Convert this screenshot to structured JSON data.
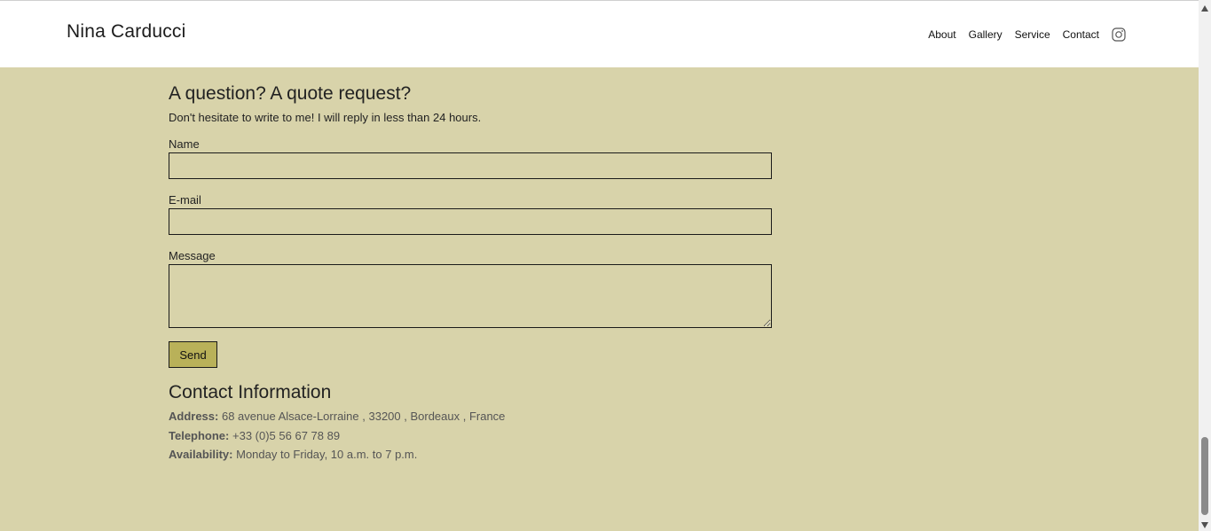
{
  "header": {
    "brand": "Nina Carducci",
    "nav": [
      "About",
      "Gallery",
      "Service",
      "Contact"
    ],
    "instagram_icon": "instagram-icon"
  },
  "form": {
    "title": "A question? A quote request?",
    "subtitle": "Don't hesitate to write to me! I will reply in less than 24 hours.",
    "name_label": "Name",
    "name_value": "",
    "email_label": "E-mail",
    "email_value": "",
    "message_label": "Message",
    "message_value": "",
    "send_label": "Send"
  },
  "contact": {
    "title": "Contact Information",
    "address_key": "Address:",
    "address_value": "68 avenue Alsace-Lorraine , 33200 , Bordeaux , France",
    "telephone_key": "Telephone:",
    "telephone_value": "+33 (0)5 56 67 78 89",
    "availability_key": "Availability:",
    "availability_value": "Monday to Friday, 10 a.m. to 7 p.m."
  },
  "colors": {
    "background": "#d8d3aa",
    "header_background": "#ffffff",
    "button_background": "#b9b159",
    "text": "#222222",
    "muted_text": "#555555"
  }
}
